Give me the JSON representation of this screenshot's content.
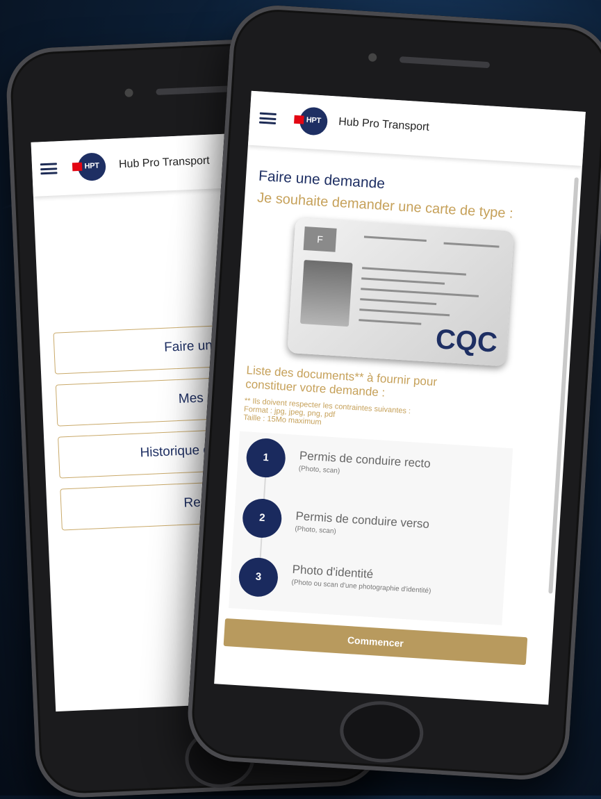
{
  "brand": {
    "initials": "HPT",
    "name": "Hub Pro Transport"
  },
  "back_screen": {
    "menu": [
      {
        "label": "Faire une demande"
      },
      {
        "label": "Mes demandes"
      },
      {
        "label": "Historique de mes demandes"
      },
      {
        "label": "Remplacement"
      }
    ]
  },
  "front_screen": {
    "title": "Faire une demande",
    "subtitle": "Je souhaite demander une carte de type :",
    "card": {
      "country": "F",
      "type_label": "CQC"
    },
    "documents_title": "Liste des documents** à fournir pour constituer votre demande :",
    "constraints": [
      "** Ils doivent respecter les contraintes suivantes :",
      "Format : jpg, jpeg, png, pdf",
      "Taille : 15Mo maximum"
    ],
    "steps": [
      {
        "number": "1",
        "label": "Permis de conduire recto",
        "hint": "(Photo, scan)"
      },
      {
        "number": "2",
        "label": "Permis de conduire verso",
        "hint": "(Photo, scan)"
      },
      {
        "number": "3",
        "label": "Photo d'identité",
        "hint": "(Photo ou scan d'une photographie d'identité)"
      }
    ],
    "cta": "Commencer"
  },
  "colors": {
    "navy": "#1e2f63",
    "gold": "#c6a15a",
    "brand_red": "#e30613",
    "button_gold": "#b89a5e"
  },
  "icons": [
    "hamburger-menu-icon",
    "hpt-logo"
  ]
}
